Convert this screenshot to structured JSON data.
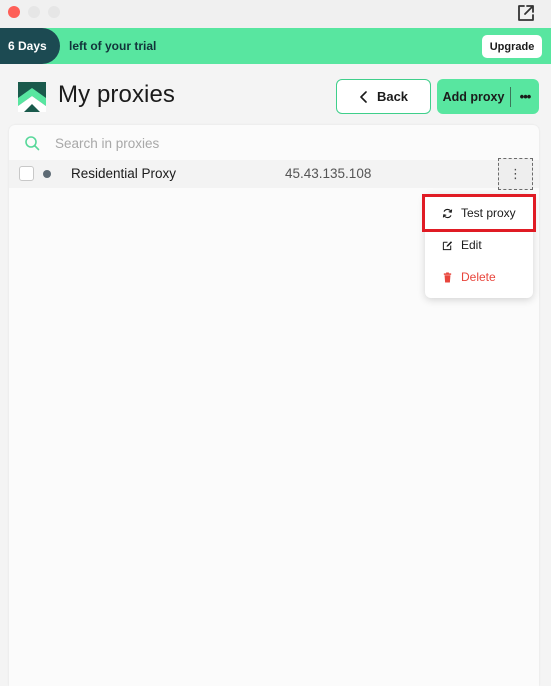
{
  "banner": {
    "days": "6 Days",
    "text": "left of your trial",
    "upgrade_label": "Upgrade"
  },
  "header": {
    "title": "My proxies",
    "back_label": "Back",
    "add_proxy_label": "Add proxy",
    "more_label": "•••"
  },
  "search": {
    "placeholder": "Search in proxies",
    "value": ""
  },
  "proxies": [
    {
      "name": "Residential Proxy",
      "ip": "45.43.135.108",
      "status_color": "#5e6b75",
      "checked": false
    }
  ],
  "row_menu_glyph": "⋮",
  "context_menu": {
    "items": [
      {
        "label": "Test proxy",
        "icon": "refresh-icon",
        "highlighted": true
      },
      {
        "label": "Edit",
        "icon": "edit-icon"
      },
      {
        "label": "Delete",
        "icon": "trash-icon",
        "color": "#e8453c"
      }
    ]
  },
  "colors": {
    "accent": "#58e6a0",
    "banner_pill": "#1c4a52",
    "danger": "#e8453c",
    "highlight": "#e01b24"
  }
}
